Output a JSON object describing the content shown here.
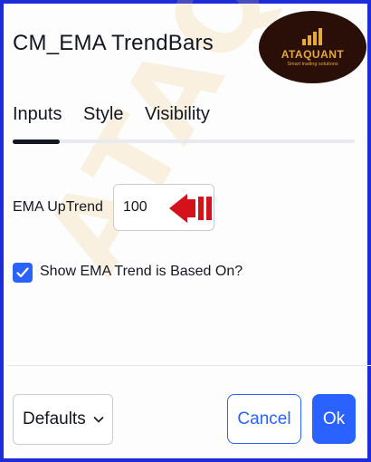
{
  "dialog": {
    "title": "CM_EMA TrendBars"
  },
  "logo": {
    "name": "ATAQUANT",
    "tagline": "Smart trading solutions"
  },
  "watermark": "ATAQUANT",
  "tabs": [
    {
      "label": "Inputs",
      "active": true
    },
    {
      "label": "Style",
      "active": false
    },
    {
      "label": "Visibility",
      "active": false
    }
  ],
  "inputs": {
    "ema_label": "EMA UpTrend",
    "ema_value": "100",
    "checkbox_label": "Show EMA Trend is Based On?",
    "checkbox_checked": true
  },
  "footer": {
    "defaults_label": "Defaults",
    "cancel_label": "Cancel",
    "ok_label": "Ok"
  },
  "colors": {
    "frame_border": "#1d2bd8",
    "accent": "#2962ff",
    "annotation_arrow": "#d3121b",
    "logo_bg": "#2a0e08",
    "logo_gold": "#e4a93a"
  },
  "icons": {
    "annotation": "red-arrow-left",
    "checkbox": "checkmark-icon",
    "defaults_dropdown": "chevron-down-icon",
    "logo": "bar-chart-logo-icon"
  }
}
